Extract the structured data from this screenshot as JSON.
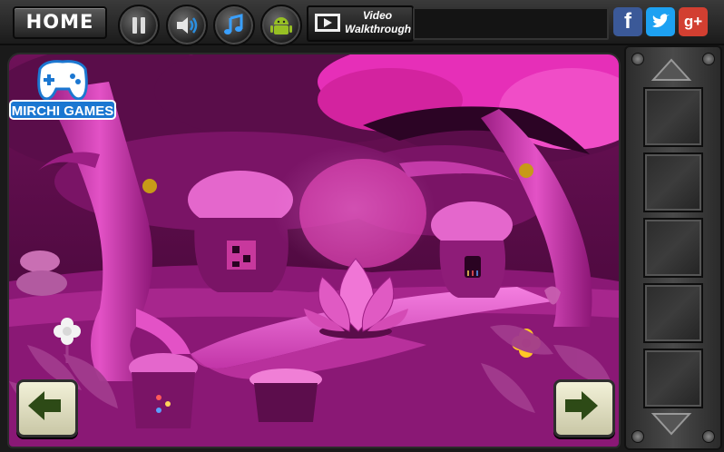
{
  "topbar": {
    "home_label": "HOME",
    "icons": [
      "pause-icon",
      "speaker-icon",
      "music-note-icon",
      "android-icon"
    ],
    "video_label_line1": "Video",
    "video_label_line2": "Walkthrough",
    "social": [
      {
        "name": "facebook",
        "glyph": "f",
        "color": "#3b5998"
      },
      {
        "name": "twitter",
        "glyph": "t",
        "color": "#1da1f2"
      },
      {
        "name": "google-plus",
        "glyph": "g+",
        "color": "#d23f31"
      }
    ]
  },
  "logo": {
    "text": "MIRCHI GAMES"
  },
  "inventory": {
    "slot_count": 5
  },
  "colors": {
    "scene_dark": "#3d0730",
    "scene_pink": "#e62fb8",
    "nav_arrow": "#2d4a16"
  }
}
